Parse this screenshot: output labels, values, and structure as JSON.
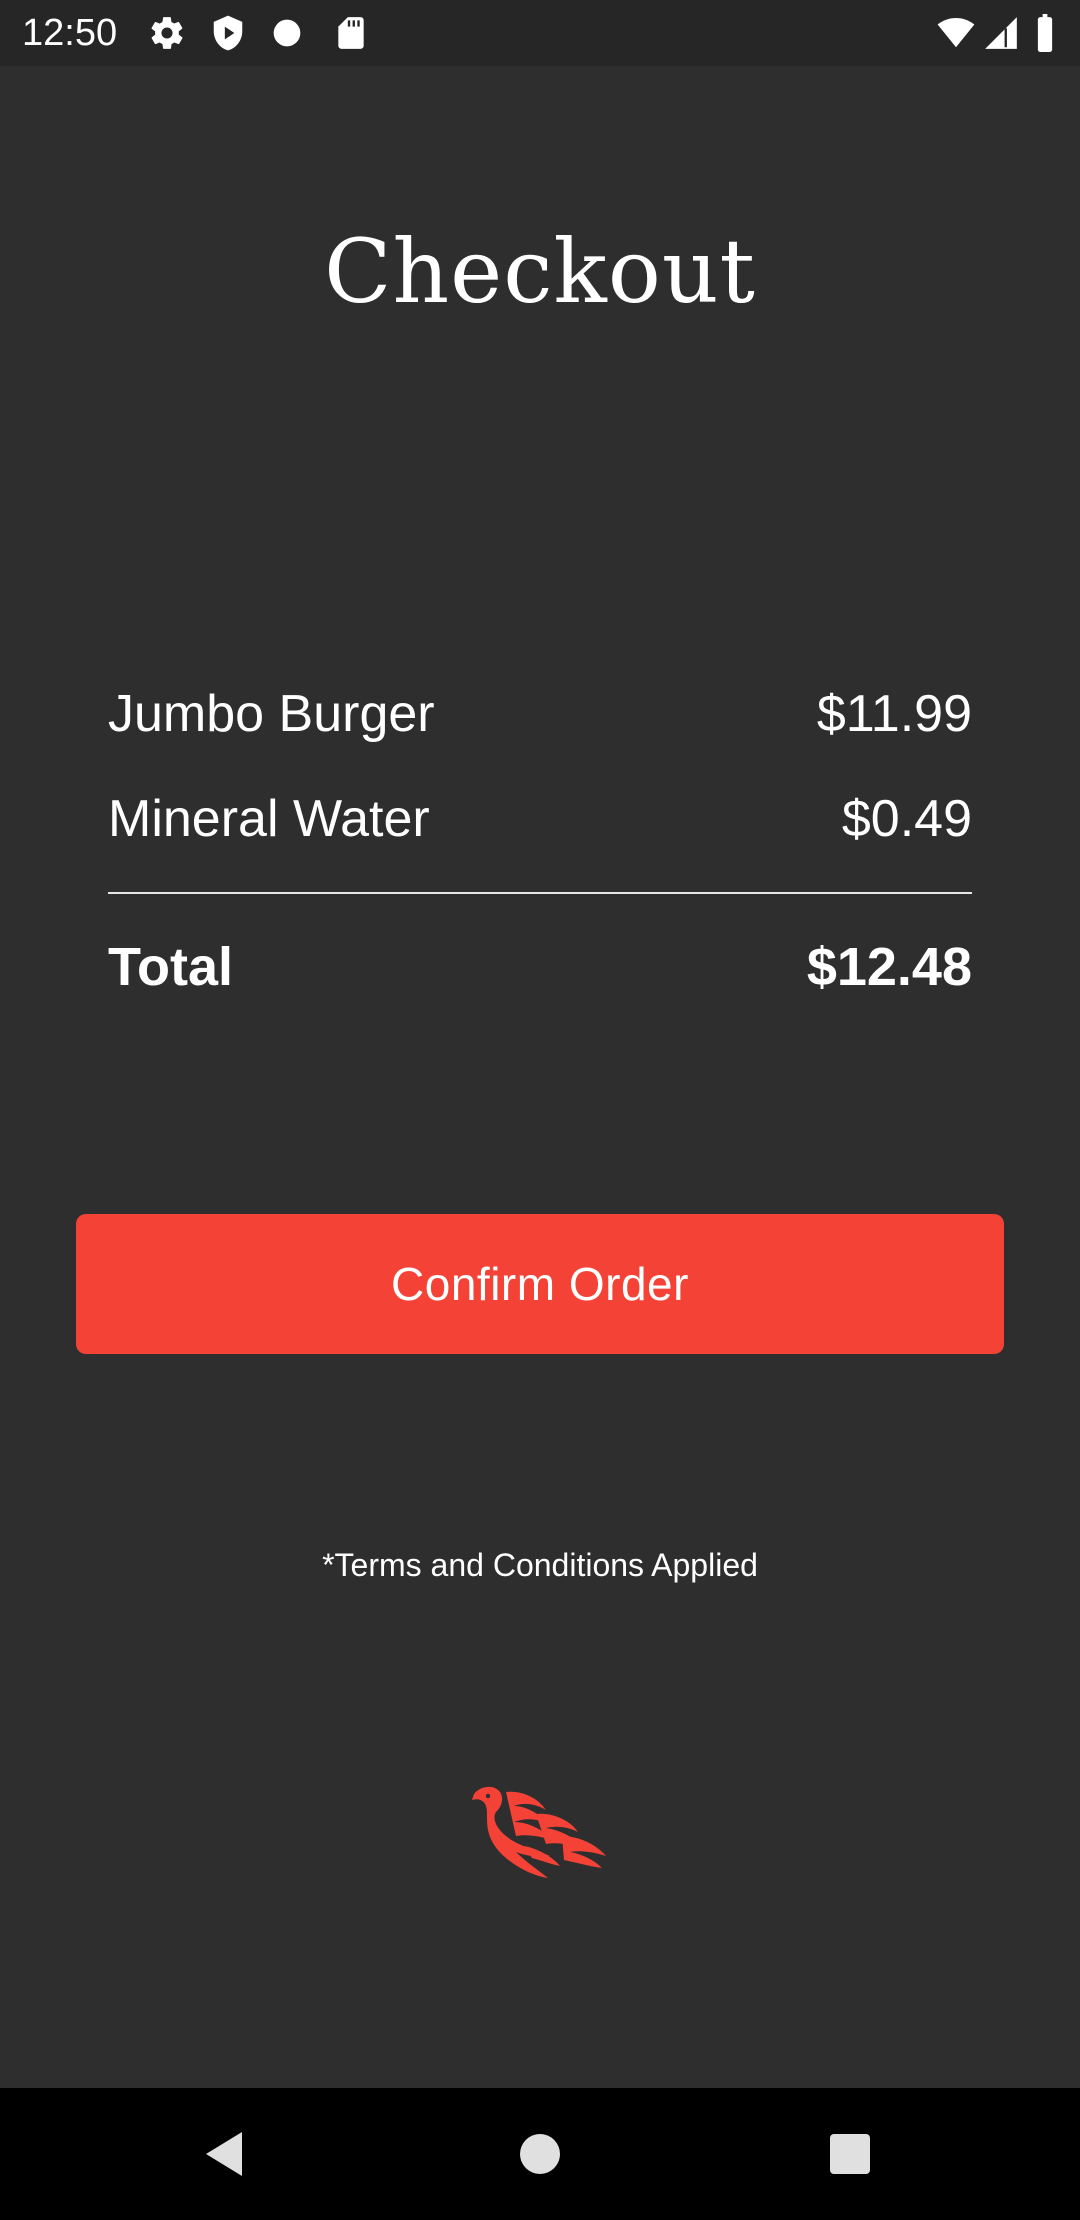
{
  "status_bar": {
    "time": "12:50",
    "left_icons": [
      "settings-gear-icon",
      "play-protect-icon",
      "dot-icon",
      "sd-card-icon"
    ],
    "right_icons": [
      "wifi-icon",
      "cell-signal-icon",
      "battery-icon"
    ]
  },
  "page": {
    "title": "Checkout"
  },
  "order": {
    "items": [
      {
        "name": "Jumbo Burger",
        "price": "$11.99"
      },
      {
        "name": "Mineral Water",
        "price": "$0.49"
      }
    ],
    "total_label": "Total",
    "total_value": "$12.48"
  },
  "actions": {
    "confirm_label": "Confirm Order"
  },
  "footer": {
    "terms": "*Terms and Conditions Applied",
    "logo_icon": "phoenix-logo-icon"
  },
  "nav": {
    "buttons": [
      "back-icon",
      "home-icon",
      "recents-icon"
    ]
  },
  "colors": {
    "background": "#2e2e2f",
    "accent": "#f44336",
    "status_bar": "#262627",
    "nav_bar": "#000000"
  }
}
